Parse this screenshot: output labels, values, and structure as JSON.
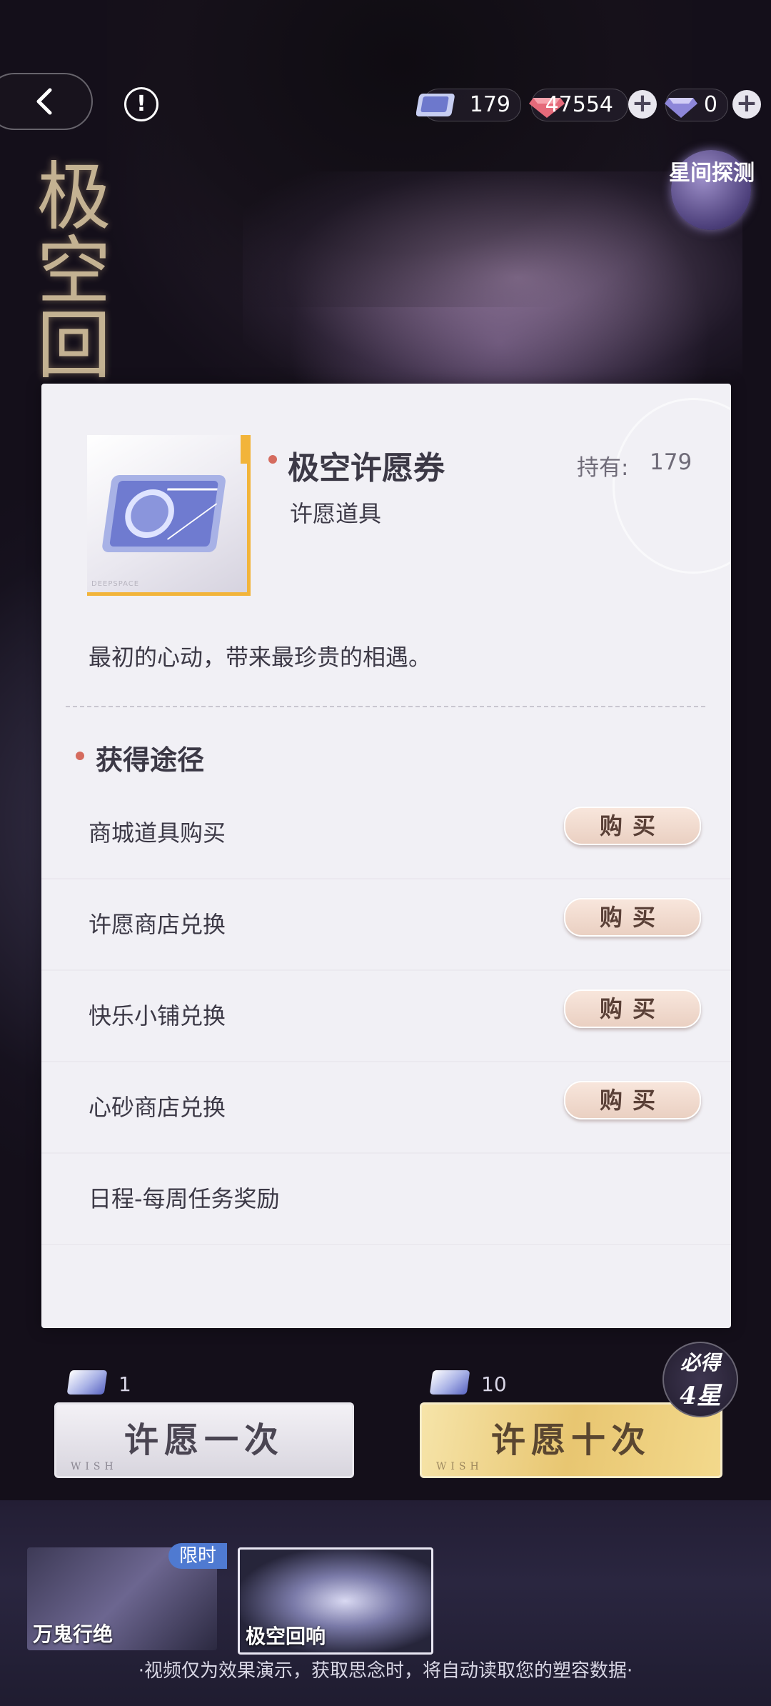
{
  "header": {
    "currencies": [
      {
        "name": "wish-ticket",
        "value": "179"
      },
      {
        "name": "ruby-gem",
        "value": "47554"
      },
      {
        "name": "diamond",
        "value": "0"
      }
    ]
  },
  "side_title": "极空回",
  "star_probe": "星间探测",
  "item": {
    "name": "极空许愿券",
    "type": "许愿道具",
    "owned_label": "持有:",
    "owned_count": "179",
    "description": "最初的心动，带来最珍贵的相遇。",
    "thumb_caption": "DEEPSPACE"
  },
  "sources": {
    "title": "获得途径",
    "buy_label": "购买",
    "items": [
      {
        "label": "商城道具购买",
        "buyable": true
      },
      {
        "label": "许愿商店兑换",
        "buyable": true
      },
      {
        "label": "快乐小铺兑换",
        "buyable": true
      },
      {
        "label": "心砂商店兑换",
        "buyable": true
      },
      {
        "label": "日程-每周任务奖励",
        "buyable": false
      }
    ]
  },
  "wish": {
    "one": {
      "label": "许愿一次",
      "cost": "1",
      "sub": "WISH"
    },
    "ten": {
      "label": "许愿十次",
      "cost": "10",
      "sub": "WISH"
    },
    "guarantee_top": "必得",
    "guarantee_bottom": "4星"
  },
  "banners": [
    {
      "label": "万鬼行绝",
      "tag": "限时"
    },
    {
      "label": "极空回响"
    }
  ],
  "footer_note": "·视频仅为效果演示，获取思念时，将自动读取您的塑容数据·"
}
